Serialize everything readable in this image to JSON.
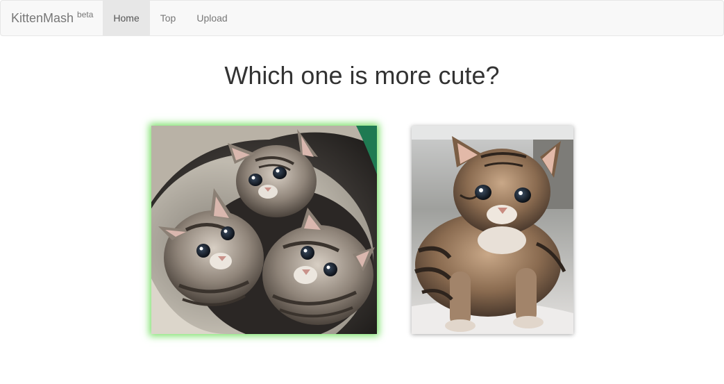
{
  "navbar": {
    "brand": "KittenMash",
    "brand_badge": "beta",
    "items": [
      {
        "label": "Home",
        "active": true
      },
      {
        "label": "Top",
        "active": false
      },
      {
        "label": "Upload",
        "active": false
      }
    ]
  },
  "main": {
    "question": "Which one is more cute?",
    "choices": [
      {
        "image": "three-kittens-in-basket-photo",
        "selected": true,
        "highlight_color": "#7be06a"
      },
      {
        "image": "single-tabby-kitten-photo",
        "selected": false
      }
    ]
  }
}
